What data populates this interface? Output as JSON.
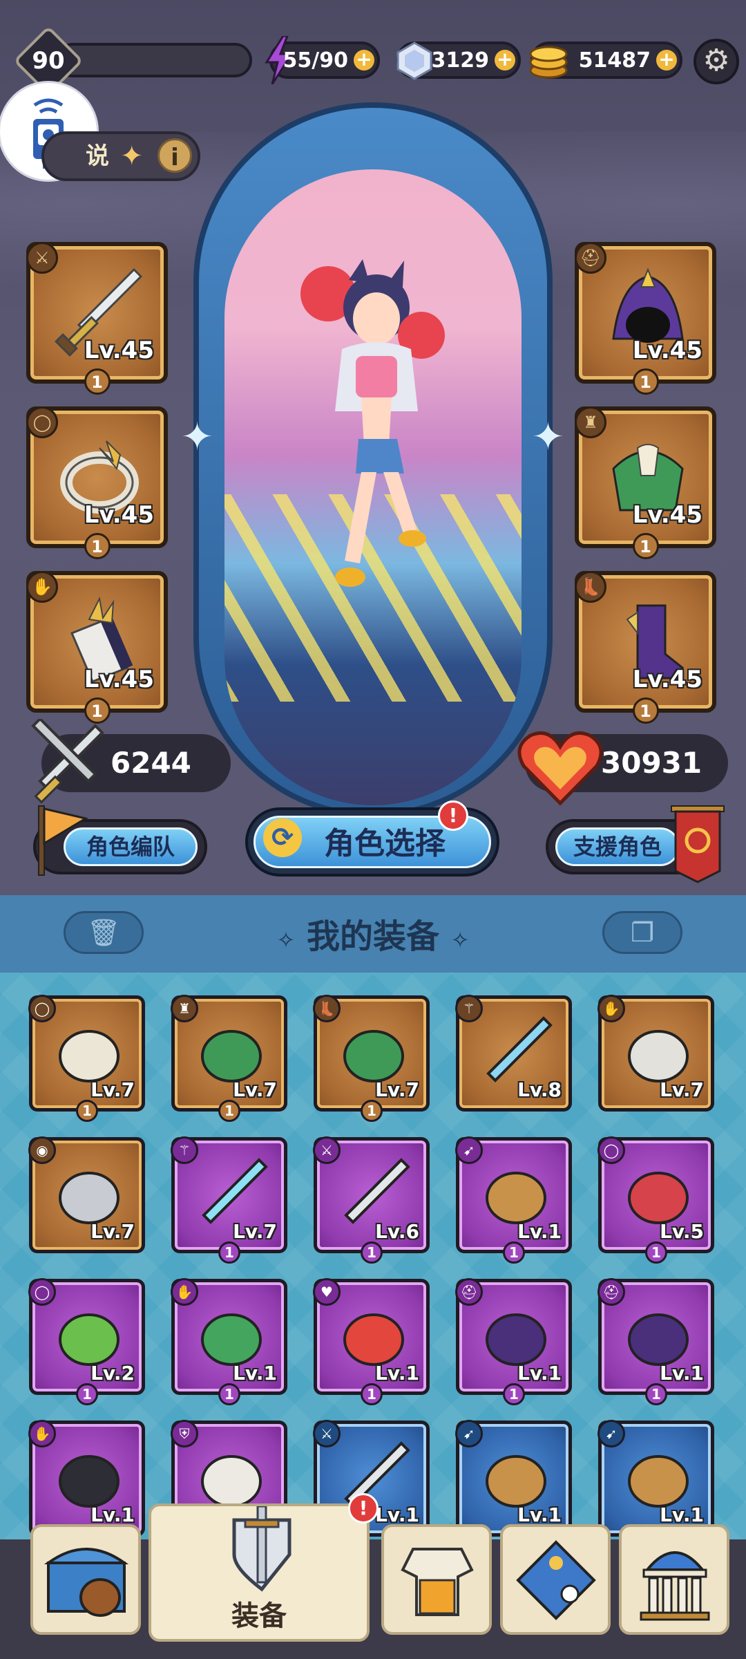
{
  "top_bar": {
    "player_level": "90",
    "xp_progress": 0.04,
    "energy": "55/90",
    "gems": "3129",
    "gold": "51487"
  },
  "hero_panel": {
    "legend_label": "说",
    "equipped_left": [
      {
        "item": "sword",
        "level": "Lv.45",
        "count": "1"
      },
      {
        "item": "ring",
        "level": "Lv.45",
        "count": "1"
      },
      {
        "item": "gauntlet",
        "level": "Lv.45",
        "count": "1"
      }
    ],
    "equipped_right": [
      {
        "item": "hood",
        "level": "Lv.45",
        "count": "1"
      },
      {
        "item": "green-armor",
        "level": "Lv.45",
        "count": "1"
      },
      {
        "item": "boots",
        "level": "Lv.45",
        "count": "1"
      }
    ],
    "attack_power": "6244",
    "health_power": "30931",
    "team_button": "角色编队",
    "select_button": "角色选择",
    "alert_mark": "!",
    "support_button": "支援角色"
  },
  "inventory": {
    "title": "我的装备",
    "items": [
      {
        "name": "ring",
        "level": "Lv.7",
        "count": "1",
        "rarity": "gold"
      },
      {
        "name": "green-armor",
        "level": "Lv.7",
        "count": "1",
        "rarity": "gold"
      },
      {
        "name": "green-boots",
        "level": "Lv.7",
        "count": "1",
        "rarity": "gold"
      },
      {
        "name": "staff",
        "level": "Lv.8",
        "count": "",
        "rarity": "gold"
      },
      {
        "name": "gauntlet",
        "level": "Lv.7",
        "count": "",
        "rarity": "gold"
      },
      {
        "name": "belt",
        "level": "Lv.7",
        "count": "",
        "rarity": "gold"
      },
      {
        "name": "crystal-staff",
        "level": "Lv.7",
        "count": "1",
        "rarity": "purple"
      },
      {
        "name": "sword",
        "level": "Lv.6",
        "count": "1",
        "rarity": "purple"
      },
      {
        "name": "bow",
        "level": "Lv.1",
        "count": "1",
        "rarity": "purple"
      },
      {
        "name": "red-ring",
        "level": "Lv.5",
        "count": "1",
        "rarity": "purple"
      },
      {
        "name": "leaf-ring",
        "level": "Lv.2",
        "count": "1",
        "rarity": "purple"
      },
      {
        "name": "green-gauntlet",
        "level": "Lv.1",
        "count": "1",
        "rarity": "purple"
      },
      {
        "name": "red-scarf",
        "level": "Lv.1",
        "count": "1",
        "rarity": "purple"
      },
      {
        "name": "hood",
        "level": "Lv.1",
        "count": "1",
        "rarity": "purple"
      },
      {
        "name": "hood",
        "level": "Lv.1",
        "count": "1",
        "rarity": "purple"
      },
      {
        "name": "black-gauntlet",
        "level": "Lv.1",
        "count": "",
        "rarity": "purple"
      },
      {
        "name": "helmet",
        "level": "",
        "count": "",
        "rarity": "purple"
      },
      {
        "name": "sword",
        "level": "Lv.1",
        "count": "",
        "rarity": "blue"
      },
      {
        "name": "bow",
        "level": "Lv.1",
        "count": "",
        "rarity": "blue"
      },
      {
        "name": "bow",
        "level": "Lv.1",
        "count": "",
        "rarity": "blue"
      }
    ]
  },
  "bottom_nav": {
    "equipment_label": "装备"
  }
}
